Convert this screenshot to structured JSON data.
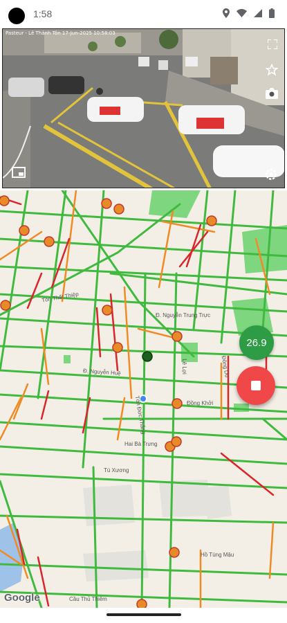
{
  "status_bar": {
    "time": "1:58",
    "icons": [
      "location-icon",
      "wifi-icon",
      "signal-icon",
      "battery-icon"
    ]
  },
  "camera": {
    "caption": "Pasteur - Lê Thánh Tôn     17-Jun-2025  10:58:03",
    "buttons": [
      "fullscreen-icon",
      "star-icon",
      "camera-icon",
      "pip-icon",
      "settings-icon"
    ]
  },
  "map": {
    "street_labels": {
      "nguyen_trung_truc": "Đ. Nguyễn Trung Trực",
      "nguyen_hue": "Đ. Nguyễn Huệ",
      "dong_khoi": "Đồng Khởi",
      "hai_ba_trung": "Hai Bà Trưng",
      "ton_duc_thang": "Tôn Đức Thắng",
      "le_loi": "Lê Lợi",
      "tu_xuong": "Tú Xương",
      "ho_tung_mau": "Hồ Tùng Mậu",
      "cau_thu_thiem": "Cầu Thủ Thiêm",
      "dong_du": "Đông Du",
      "ton_that_thiep": "Tôn Thất Thiệp"
    },
    "attribution": "Google",
    "speed_value": "26.9"
  },
  "colors": {
    "traffic_green": "#3fba3f",
    "traffic_orange": "#f08a24",
    "traffic_red": "#d8262b",
    "speed_badge": "#2e9b45",
    "stop_button": "#f04848"
  }
}
